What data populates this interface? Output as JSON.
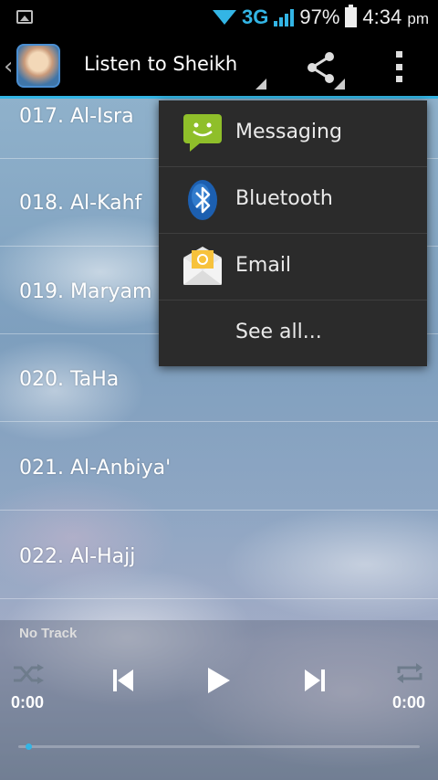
{
  "status_bar": {
    "network": "3G",
    "battery": "97%",
    "time": "4:34",
    "ampm": "pm"
  },
  "action_bar": {
    "title": "Listen to Sheikh A",
    "icons": [
      "app-icon",
      "share-icon",
      "overflow-menu-icon"
    ]
  },
  "tracks": [
    "017. Al-Isra",
    "018. Al-Kahf",
    "019. Maryam",
    "020. TaHa",
    "021. Al-Anbiya'",
    "022. Al-Hajj"
  ],
  "player": {
    "track_label": "No Track",
    "elapsed": "0:00",
    "total": "0:00",
    "progress": 0
  },
  "share_menu": {
    "items": [
      {
        "label": "Messaging",
        "icon": "messaging-icon"
      },
      {
        "label": "Bluetooth",
        "icon": "bluetooth-icon"
      },
      {
        "label": "Email",
        "icon": "email-icon"
      },
      {
        "label": "See all...",
        "icon": ""
      }
    ]
  },
  "colors": {
    "accent": "#33b5e5",
    "menu_bg": "#2b2b2b"
  }
}
